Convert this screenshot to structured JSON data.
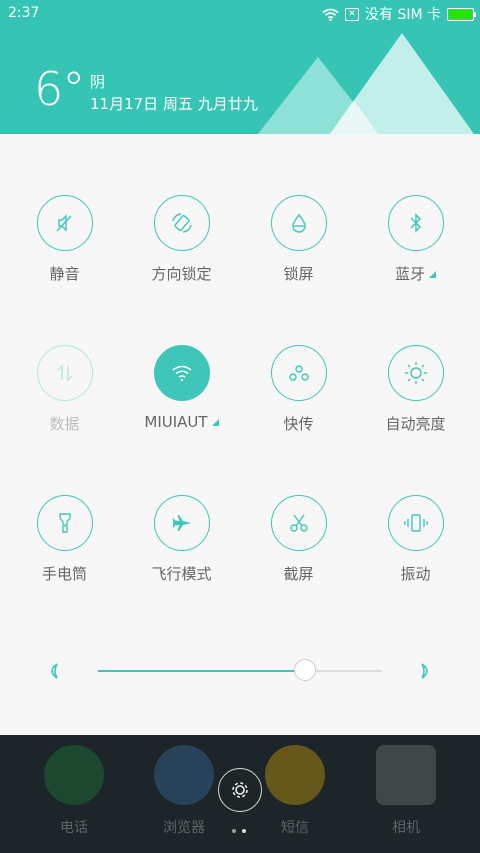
{
  "status": {
    "time": "2:37",
    "carrier": "没有 SIM 卡",
    "battery_color": "#21e600"
  },
  "weather": {
    "temperature": "6°",
    "condition": "阴",
    "date": "11月17日 周五 九月廿九"
  },
  "toggles": [
    {
      "label": "静音",
      "icon": "mute-icon",
      "state": "off"
    },
    {
      "label": "方向锁定",
      "icon": "rotation-lock-icon",
      "state": "off"
    },
    {
      "label": "锁屏",
      "icon": "lock-screen-icon",
      "state": "off"
    },
    {
      "label": "蓝牙",
      "icon": "bluetooth-icon",
      "state": "off",
      "has_more": true
    },
    {
      "label": "数据",
      "icon": "mobile-data-icon",
      "state": "disabled"
    },
    {
      "label": "MIUIAUT",
      "icon": "wifi-icon",
      "state": "on",
      "has_more": true
    },
    {
      "label": "快传",
      "icon": "quick-share-icon",
      "state": "off"
    },
    {
      "label": "自动亮度",
      "icon": "auto-brightness-icon",
      "state": "off"
    },
    {
      "label": "手电筒",
      "icon": "flashlight-icon",
      "state": "off"
    },
    {
      "label": "飞行模式",
      "icon": "airplane-icon",
      "state": "off"
    },
    {
      "label": "截屏",
      "icon": "screenshot-icon",
      "state": "off"
    },
    {
      "label": "振动",
      "icon": "vibrate-icon",
      "state": "off"
    }
  ],
  "brightness": {
    "level": 0.73
  },
  "dock": {
    "apps": [
      {
        "label": "电话",
        "icon": "phone-icon",
        "color": "#1e8a3f"
      },
      {
        "label": "浏览器",
        "icon": "browser-icon",
        "color": "#3b79b5"
      },
      {
        "label": "短信",
        "icon": "messages-icon",
        "color": "#f0b400"
      },
      {
        "label": "相机",
        "icon": "camera-icon",
        "color": "#888888"
      }
    ]
  },
  "colors": {
    "accent": "#3ec7b8",
    "header": "#36c5b5"
  }
}
